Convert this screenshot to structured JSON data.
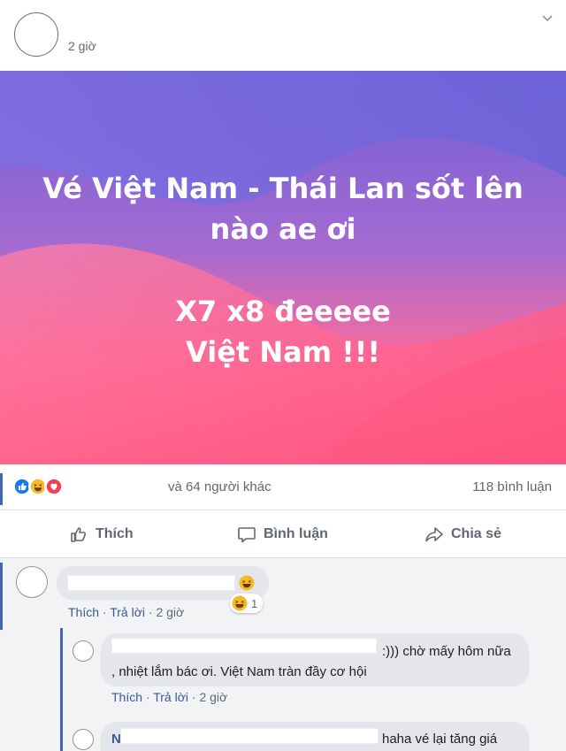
{
  "post": {
    "time": "2 giờ",
    "banner_lines": [
      "Vé Việt Nam - Thái Lan sốt lên",
      "nào ae ơi",
      "X7 x8 đeeeee",
      "Việt Nam !!!"
    ],
    "colors": {
      "banner_top": "#7a63d8",
      "banner_bottom": "#ff6b8f",
      "accent": "#4267b2",
      "like_blue": "#1877f2",
      "love_red": "#f33e58",
      "haha_yellow": "#f7b928"
    }
  },
  "reactions": {
    "icons": [
      "like-icon",
      "haha-icon",
      "love-icon"
    ],
    "others_text": "và 64 người khác",
    "comments_count": "118 bình luận"
  },
  "actions": {
    "like_label": "Thích",
    "comment_label": "Bình luận",
    "share_label": "Chia sẻ"
  },
  "comments": [
    {
      "text": "",
      "like_label": "Thích",
      "reply_label": "Trả lời",
      "time": "2 giờ",
      "reaction_count": "1"
    },
    {
      "text_line1": ":))) chờ mấy hôm nữa",
      "text_line2": ", nhiệt lắm bác ơi. Việt Nam tràn đầy cơ hội",
      "like_label": "Thích",
      "reply_label": "Trả lời",
      "time": "2 giờ"
    },
    {
      "initial": "N",
      "text": "haha vé lại tăng giá"
    }
  ]
}
